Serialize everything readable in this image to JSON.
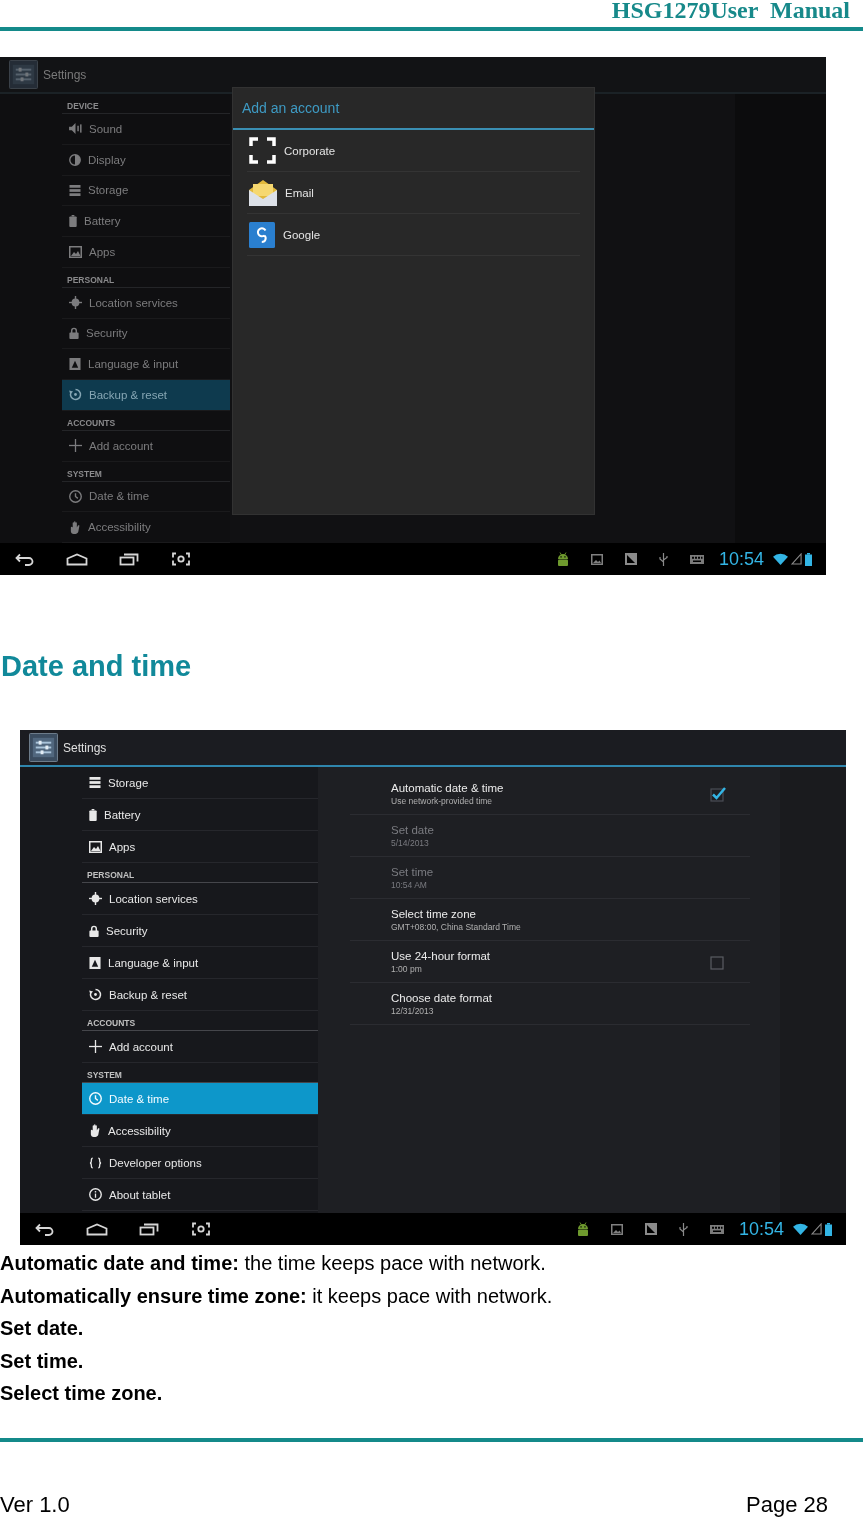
{
  "header": {
    "title": "HSG1279User  Manual"
  },
  "account_screenshot": {
    "action_bar": {
      "title": "Settings"
    },
    "sidebar": {
      "sections": [
        {
          "header": "DEVICE",
          "items": [
            {
              "label": "Sound",
              "selected": false
            },
            {
              "label": "Display",
              "selected": false
            },
            {
              "label": "Storage",
              "selected": false
            },
            {
              "label": "Battery",
              "selected": false
            },
            {
              "label": "Apps",
              "selected": false
            }
          ]
        },
        {
          "header": "PERSONAL",
          "items": [
            {
              "label": "Location services",
              "selected": false
            },
            {
              "label": "Security",
              "selected": false
            },
            {
              "label": "Language & input",
              "selected": false
            },
            {
              "label": "Backup & reset",
              "selected": true
            }
          ]
        },
        {
          "header": "ACCOUNTS",
          "items": [
            {
              "label": "Add account",
              "selected": false
            }
          ]
        },
        {
          "header": "SYSTEM",
          "items": [
            {
              "label": "Date & time",
              "selected": false
            },
            {
              "label": "Accessibility",
              "selected": false
            }
          ]
        }
      ]
    },
    "dialog": {
      "title": "Add an account",
      "items": [
        {
          "label": "Corporate"
        },
        {
          "label": "Email"
        },
        {
          "label": "Google"
        }
      ]
    },
    "status_bar": {
      "time": "10:54"
    }
  },
  "section_heading": "Date and time",
  "date_time_screenshot": {
    "action_bar": {
      "title": "Settings"
    },
    "sidebar": {
      "sections": [
        {
          "items": [
            {
              "label": "Storage",
              "selected": false
            },
            {
              "label": "Battery",
              "selected": false
            },
            {
              "label": "Apps",
              "selected": false
            }
          ]
        },
        {
          "header": "PERSONAL",
          "items": [
            {
              "label": "Location services",
              "selected": false
            },
            {
              "label": "Security",
              "selected": false
            },
            {
              "label": "Language & input",
              "selected": false
            },
            {
              "label": "Backup & reset",
              "selected": false
            }
          ]
        },
        {
          "header": "ACCOUNTS",
          "items": [
            {
              "label": "Add account",
              "selected": false
            }
          ]
        },
        {
          "header": "SYSTEM",
          "items": [
            {
              "label": "Date & time",
              "selected": true
            },
            {
              "label": "Accessibility",
              "selected": false
            },
            {
              "label": "Developer options",
              "selected": false
            },
            {
              "label": "About tablet",
              "selected": false
            }
          ]
        }
      ]
    },
    "details": {
      "items": [
        {
          "kind": "checkbox",
          "title": "Automatic date & time",
          "summary": "Use network-provided time",
          "checked": true,
          "disabled": false
        },
        {
          "kind": "text",
          "title": "Set date",
          "summary": "5/14/2013",
          "disabled": true
        },
        {
          "kind": "text",
          "title": "Set time",
          "summary": "10:54 AM",
          "disabled": true
        },
        {
          "kind": "text",
          "title": "Select time zone",
          "summary": "GMT+08:00, China Standard Time",
          "disabled": false
        },
        {
          "kind": "checkbox",
          "title": "Use 24-hour format",
          "summary": "1:00 pm",
          "checked": false,
          "disabled": false
        },
        {
          "kind": "text",
          "title": "Choose date format",
          "summary": "12/31/2013",
          "disabled": false
        }
      ]
    },
    "status_bar": {
      "time": "10:54"
    }
  },
  "descriptions": [
    {
      "term": "Automatic date and time:",
      "text": "the time keeps pace with network."
    },
    {
      "term": "Automatically ensure time zone:",
      "text": "it keeps pace with network."
    },
    {
      "term": "Set date."
    },
    {
      "term": "Set time."
    },
    {
      "term": "Select time zone."
    }
  ],
  "footer": {
    "version": "Ver 1.0",
    "page": "Page 28"
  }
}
